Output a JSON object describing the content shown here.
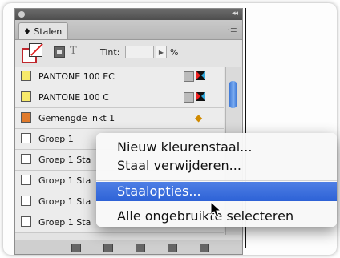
{
  "panel": {
    "tab_label": "♦ Stalen",
    "tab_menu_icon": "·≡",
    "tint_label": "Tint:",
    "tint_value": "",
    "tint_unit": "%",
    "text_button": "T"
  },
  "swatches": [
    {
      "name": "PANTONE 100 EC",
      "color": "#f7e96a",
      "icons": "cmyk-spot"
    },
    {
      "name": "PANTONE 100 C",
      "color": "#f7e96a",
      "icons": "cmyk-spot"
    },
    {
      "name": "Gemengde inkt 1",
      "color": "#e07a2c",
      "icons": "mixed"
    },
    {
      "name": "Groep 1",
      "color": "#ffffff",
      "icons": "none"
    },
    {
      "name": "Groep 1 Sta",
      "color": "#ffffff",
      "icons": "none"
    },
    {
      "name": "Groep 1 Sta",
      "color": "#ffffff",
      "icons": "none"
    },
    {
      "name": "Groep 1 Sta",
      "color": "#ffffff",
      "icons": "none"
    },
    {
      "name": "Groep 1 Sta",
      "color": "#ffffff",
      "icons": "none"
    }
  ],
  "context_menu": {
    "items": [
      {
        "label": "Nieuw kleurenstaal...",
        "highlighted": false
      },
      {
        "label": "Staal verwijderen...",
        "highlighted": false
      },
      {
        "label": "Staalopties...",
        "highlighted": true
      },
      {
        "label": "Alle ongebruikte selecteren",
        "highlighted": false
      }
    ]
  }
}
